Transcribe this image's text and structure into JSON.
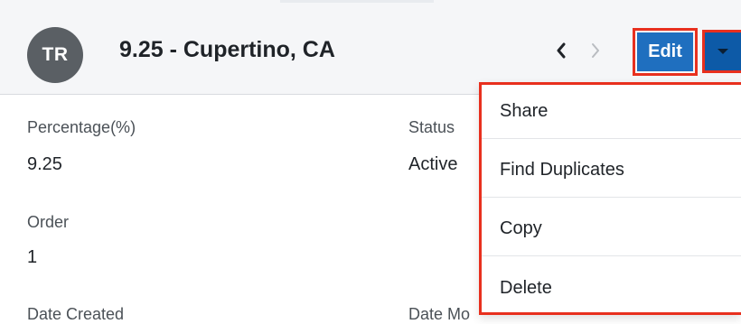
{
  "header": {
    "avatar_initials": "TR",
    "record_title": "9.25 - Cupertino, CA",
    "edit_label": "Edit"
  },
  "fields": {
    "percentage": {
      "label": "Percentage(%)",
      "value": "9.25"
    },
    "status": {
      "label": "Status",
      "value": "Active"
    },
    "order": {
      "label": "Order",
      "value": "1"
    },
    "date_created": {
      "label": "Date Created"
    },
    "date_modified": {
      "label": "Date Mo"
    }
  },
  "actions_menu": {
    "items": [
      {
        "label": "Share"
      },
      {
        "label": "Find Duplicates"
      },
      {
        "label": "Copy"
      },
      {
        "label": "Delete"
      }
    ]
  },
  "colors": {
    "primary_button": "#1f6fbf",
    "caret_button": "#0d5aa7",
    "highlight_outline": "#e8301e",
    "avatar_bg": "#5a5f64"
  },
  "icons": {
    "prev": "chevron-left-icon",
    "next": "chevron-right-icon",
    "caret": "caret-down-icon"
  }
}
